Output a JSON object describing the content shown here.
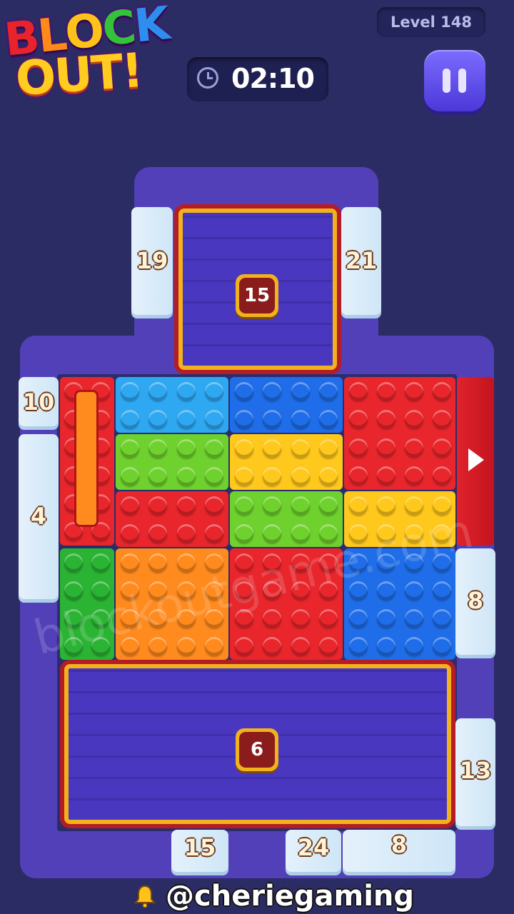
{
  "header": {
    "logo_line1": [
      "B",
      "L",
      "O",
      "C",
      "K"
    ],
    "logo_line2": "OUT!",
    "level": "Level 148",
    "timer": "02:10",
    "logo_colors": [
      "#e8232c",
      "#ff8a1a",
      "#ffc21a",
      "#35c23a",
      "#2e8ef0"
    ]
  },
  "trays": {
    "top_count": "15",
    "bottom_count": "6"
  },
  "gates": {
    "top_left": "19",
    "top_right": "21",
    "left_upper": "10",
    "left_lower": "4",
    "right_middle": "8",
    "right_lower": "13",
    "bottom_1": "15",
    "bottom_2": "24",
    "bottom_3": "8"
  },
  "blocks": [
    {
      "name": "block-red-vertical",
      "color": "#e8262c"
    },
    {
      "name": "block-lightblue",
      "color": "#2fa8f2"
    },
    {
      "name": "block-blue-top",
      "color": "#1f6de8"
    },
    {
      "name": "block-red-large-top",
      "color": "#e8262c"
    },
    {
      "name": "block-green-light-1",
      "color": "#6fd12e"
    },
    {
      "name": "block-yellow-1",
      "color": "#ffc81c"
    },
    {
      "name": "block-red-mid",
      "color": "#e8262c"
    },
    {
      "name": "block-green-light-2",
      "color": "#6fd12e"
    },
    {
      "name": "block-yellow-2",
      "color": "#ffc81c"
    },
    {
      "name": "block-green-dark",
      "color": "#2bb334"
    },
    {
      "name": "block-orange",
      "color": "#ff8a1e"
    },
    {
      "name": "block-red-bottom",
      "color": "#e8262c"
    },
    {
      "name": "block-blue-bottom",
      "color": "#1f6de8"
    }
  ],
  "watermark": "blockoutgame.com",
  "credit": "@cheriegaming",
  "icons": [
    "clock-icon",
    "pause-icon",
    "exit-arrow-icon",
    "bell-icon"
  ]
}
